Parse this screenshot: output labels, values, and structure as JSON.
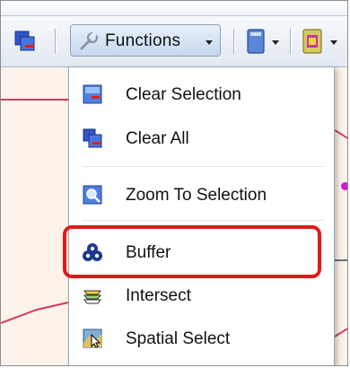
{
  "toolbar": {
    "functions_label": "Functions"
  },
  "menu": {
    "items": [
      {
        "label": "Clear Selection",
        "icon": "clear-selection-icon"
      },
      {
        "label": "Clear All",
        "icon": "clear-all-icon"
      },
      {
        "label": "Zoom To Selection",
        "icon": "zoom-to-selection-icon"
      },
      {
        "label": "Buffer",
        "icon": "buffer-icon"
      },
      {
        "label": "Intersect",
        "icon": "intersect-icon"
      },
      {
        "label": "Spatial Select",
        "icon": "spatial-select-icon"
      }
    ]
  },
  "colors": {
    "highlight": "#e01a1a",
    "map_line": "#d9385e",
    "map_bg": "#fdf3ea",
    "accent_dot": "#d21ad6"
  }
}
